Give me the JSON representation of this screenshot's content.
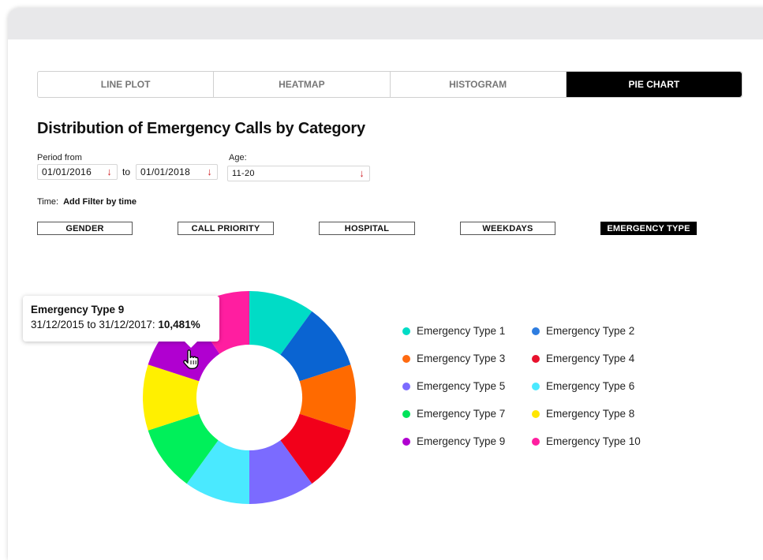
{
  "tabs": [
    {
      "label": "LINE PLOT",
      "active": false
    },
    {
      "label": "HEATMAP",
      "active": false
    },
    {
      "label": "HISTOGRAM",
      "active": false
    },
    {
      "label": "PIE CHART",
      "active": true
    }
  ],
  "title": "Distribution of Emergency Calls by Category",
  "period": {
    "label": "Period from",
    "from": "01/01/2016",
    "to_label": "to",
    "to": "01/01/2018"
  },
  "age": {
    "label": "Age:",
    "value": "11-20"
  },
  "time": {
    "label": "Time:",
    "action": "Add Filter by time"
  },
  "filters": [
    {
      "label": "GENDER",
      "active": false
    },
    {
      "label": "CALL PRIORITY",
      "active": false
    },
    {
      "label": "HOSPITAL",
      "active": false
    },
    {
      "label": "WEEKDAYS",
      "active": false
    },
    {
      "label": "EMERGENCY TYPE",
      "active": true
    }
  ],
  "tooltip": {
    "title": "Emergency Type 9",
    "range": "31/12/2015 to 31/12/2017: ",
    "value": "10,481%"
  },
  "chart_data": {
    "type": "pie",
    "donut": true,
    "categories": [
      "Emergency Type 1",
      "Emergency Type 2",
      "Emergency Type 3",
      "Emergency Type 4",
      "Emergency Type 5",
      "Emergency Type 6",
      "Emergency Type 7",
      "Emergency Type 8",
      "Emergency Type 9",
      "Emergency Type 10"
    ],
    "values": [
      10,
      10,
      10,
      10,
      10,
      10,
      10,
      10,
      10.481,
      9.519
    ],
    "colors": [
      "#00dcc6",
      "#0a64d2",
      "#ff6a00",
      "#f2001a",
      "#7b6bff",
      "#4ae9ff",
      "#00f05a",
      "#fff000",
      "#b000d0",
      "#ff1ea0"
    ],
    "legend_placement": "right"
  },
  "legend": [
    {
      "label": "Emergency Type 1",
      "color": "#00dcc6"
    },
    {
      "label": "Emergency Type 2",
      "color": "#2e7de0"
    },
    {
      "label": "Emergency Type 3",
      "color": "#ff6a10"
    },
    {
      "label": "Emergency Type 4",
      "color": "#e8112d"
    },
    {
      "label": "Emergency Type 5",
      "color": "#7b6bff"
    },
    {
      "label": "Emergency Type 6",
      "color": "#4ae9ff"
    },
    {
      "label": "Emergency Type 7",
      "color": "#00e35a"
    },
    {
      "label": "Emergency Type 8",
      "color": "#ffe600"
    },
    {
      "label": "Emergency Type 9",
      "color": "#b000d0"
    },
    {
      "label": "Emergency Type 10",
      "color": "#ff1ea0"
    }
  ]
}
